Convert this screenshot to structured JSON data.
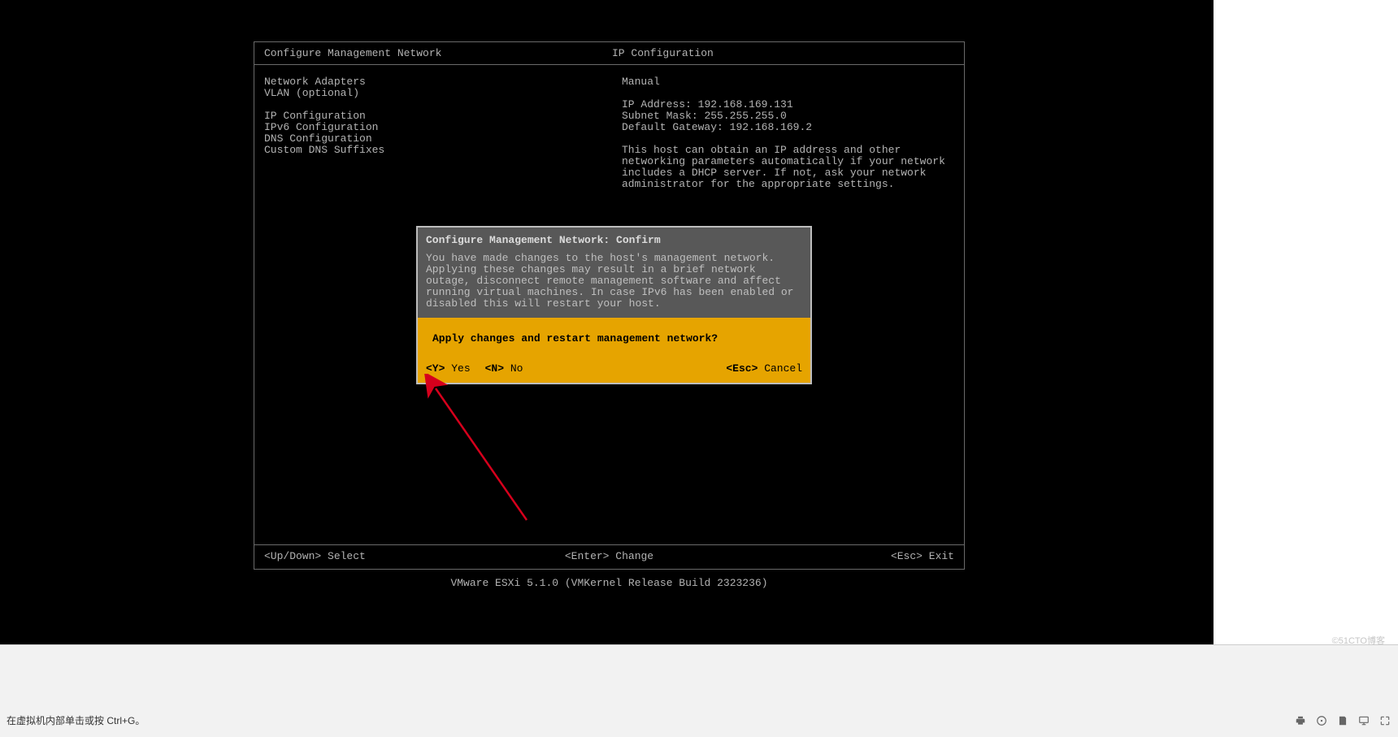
{
  "panel": {
    "header_left": "Configure Management Network",
    "header_right": "IP Configuration",
    "sidebar": {
      "items": [
        "Network Adapters",
        "VLAN (optional)",
        "",
        "IP Configuration",
        "IPv6 Configuration",
        "DNS Configuration",
        "Custom DNS Suffixes"
      ]
    },
    "main": {
      "mode": "Manual",
      "ip_label": "IP Address:",
      "ip_value": "192.168.169.131",
      "mask_label": "Subnet Mask:",
      "mask_value": "255.255.255.0",
      "gw_label": "Default Gateway:",
      "gw_value": "192.168.169.2",
      "desc": "This host can obtain an IP address and other networking parameters automatically if your network includes a DHCP server. If not, ask your network administrator for the appropriate settings."
    },
    "footer": {
      "left_key": "<Up/Down>",
      "left_label": "Select",
      "center_key": "<Enter>",
      "center_label": "Change",
      "right_key": "<Esc>",
      "right_label": "Exit"
    }
  },
  "version": "VMware ESXi 5.1.0 (VMKernel Release Build 2323236)",
  "dialog": {
    "title": "Configure Management Network: Confirm",
    "body": "You have made changes to the host's management network. Applying these changes may result in a brief network outage, disconnect remote management software and affect running virtual machines. In case IPv6 has been enabled or disabled this will restart your host.",
    "question": "Apply changes and restart management network?",
    "yes_key": "<Y>",
    "yes_label": "Yes",
    "no_key": "<N>",
    "no_label": "No",
    "cancel_key": "<Esc>",
    "cancel_label": "Cancel"
  },
  "host": {
    "hint": "在虚拟机内部单击或按 Ctrl+G。"
  },
  "watermark": "©51CTO博客"
}
